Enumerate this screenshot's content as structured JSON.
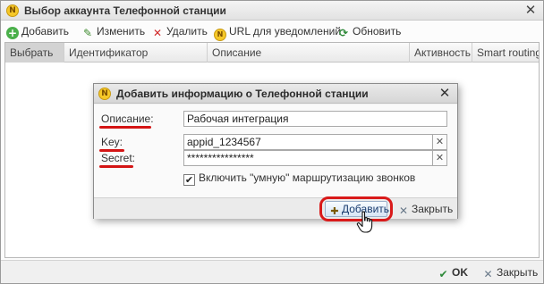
{
  "window": {
    "title": "Выбор аккаунта Телефонной станции",
    "close_glyph": "✕"
  },
  "toolbar": {
    "add": "Добавить",
    "edit": "Изменить",
    "delete": "Удалить",
    "url": "URL для уведомлений",
    "refresh": "Обновить"
  },
  "grid": {
    "columns": [
      "Выбрать",
      "Идентификатор",
      "Описание",
      "Активность",
      "Smart routing"
    ]
  },
  "status_bar": {
    "ok": "OK",
    "close": "Закрыть"
  },
  "dialog": {
    "title": "Добавить информацию о Телефонной станции",
    "fields": {
      "description_label": "Описание:",
      "description_value": "Рабочая интеграция",
      "key_label": "Key:",
      "key_value": "appid_1234567",
      "secret_label": "Secret:",
      "secret_value": "****************"
    },
    "checkbox_label": "Включить \"умную\" маршрутизацию звонков",
    "checkbox_checked": true,
    "add_button": "Добавить",
    "close_button": "Закрыть"
  },
  "colors": {
    "annotation_red": "#d41414",
    "logo_yellow": "#f6c828"
  },
  "icons": [
    "app-logo-icon",
    "add-icon",
    "pencil-icon",
    "delete-icon",
    "url-icon",
    "refresh-icon",
    "ok-icon",
    "close-icon",
    "clear-icon",
    "checkbox-icon",
    "hand-cursor-icon"
  ]
}
